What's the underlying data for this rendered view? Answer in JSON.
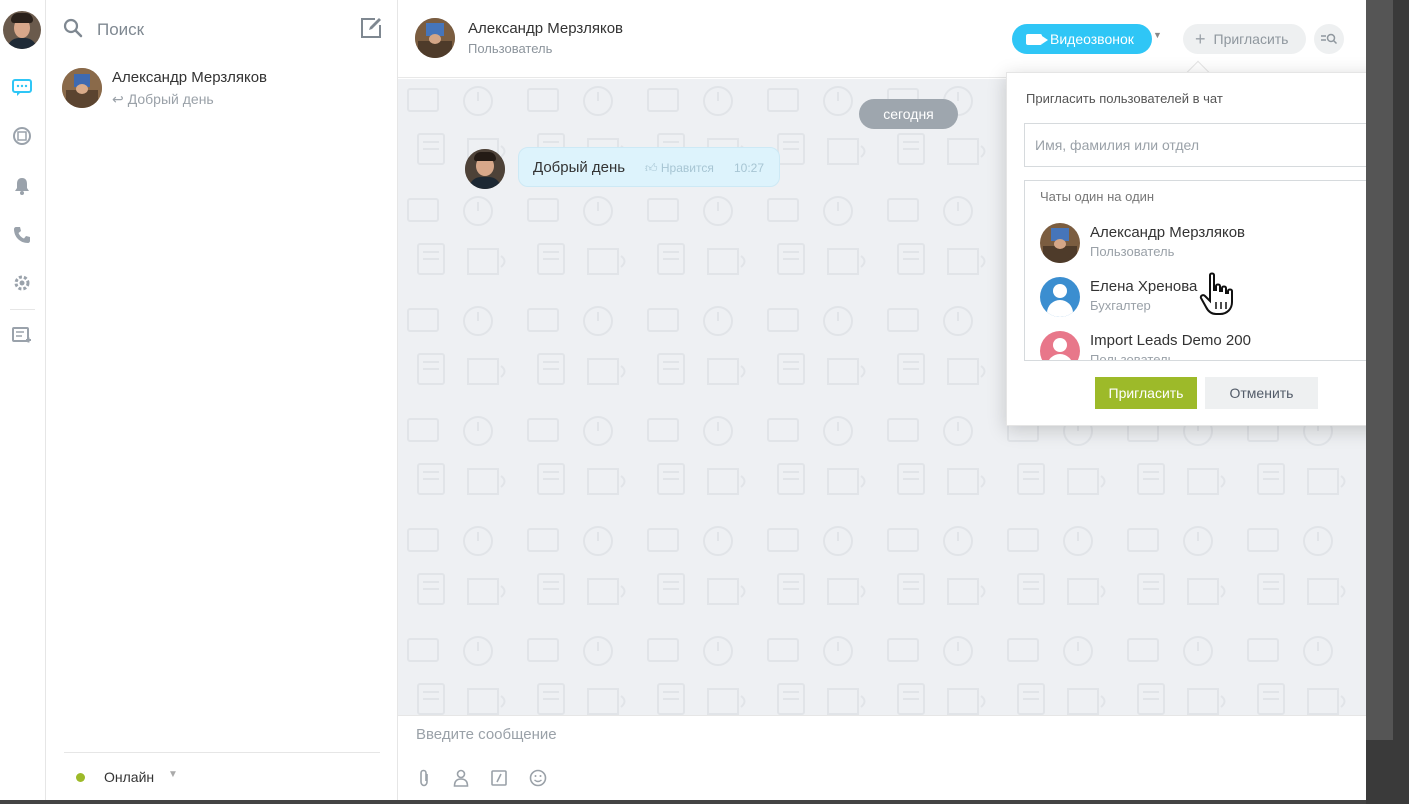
{
  "sidebar": {
    "icons": [
      "messenger-icon",
      "live-feed-icon",
      "notifications-icon",
      "phone-icon",
      "settings-icon",
      "new-chat-icon"
    ]
  },
  "recent": {
    "search_label": "Поиск",
    "items": [
      {
        "name": "Александр Мерзляков",
        "last_message": "Добрый день"
      }
    ],
    "status": {
      "label": "Онлайн",
      "color": "#9dba29"
    }
  },
  "chat": {
    "title": "Александр Мерзляков",
    "subtitle": "Пользователь",
    "video_button": "Видеозвонок",
    "invite_button": "Пригласить",
    "date_separator": "сегодня",
    "messages": [
      {
        "text": "Добрый день",
        "like_label": "Нравится",
        "time": "10:27"
      }
    ],
    "composer_placeholder": "Введите сообщение"
  },
  "invite_popup": {
    "title": "Пригласить пользователей в чат",
    "search_placeholder": "Имя, фамилия или отдел",
    "section_label": "Чаты один на один",
    "users": [
      {
        "name": "Александр Мерзляков",
        "role": "Пользователь"
      },
      {
        "name": "Елена Хренова",
        "role": "Бухгалтер"
      },
      {
        "name": "Import Leads Demo 200",
        "role": "Пользователь"
      }
    ],
    "confirm_button": "Пригласить",
    "cancel_button": "Отменить"
  },
  "colors": {
    "accent_blue": "#2fc6f6",
    "confirm_green": "#9dba29",
    "avatar_blue": "#3b8ed0",
    "avatar_pink": "#e8778a"
  }
}
